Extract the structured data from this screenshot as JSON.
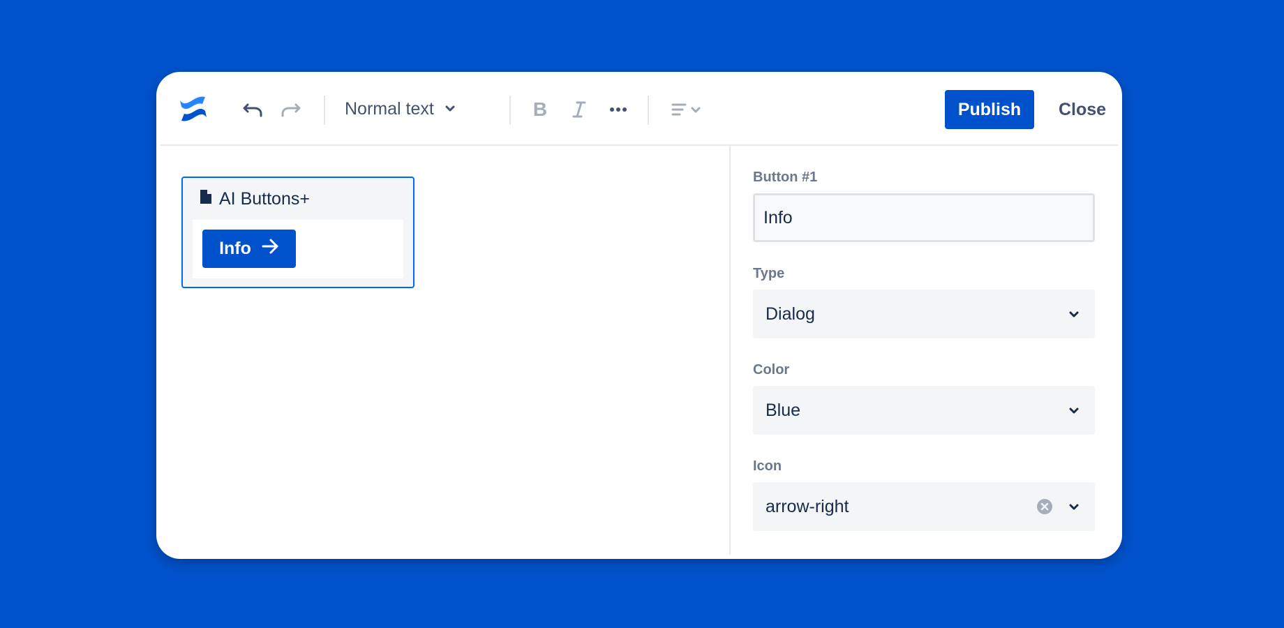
{
  "toolbar": {
    "text_style": "Normal text",
    "bold_label": "B",
    "publish_label": "Publish",
    "close_label": "Close",
    "icons": [
      "confluence-logo-icon",
      "undo-icon",
      "redo-icon",
      "chevron-down-icon",
      "bold-icon",
      "italic-icon",
      "more-icon",
      "align-left-icon"
    ]
  },
  "macro": {
    "title": "AI Buttons+",
    "icon": "document-icon",
    "button": {
      "label": "Info",
      "icon": "arrow-right-icon"
    }
  },
  "panel": {
    "button_label": "Button #1",
    "button_value": "Info",
    "type_label": "Type",
    "type_value": "Dialog",
    "color_label": "Color",
    "color_value": "Blue",
    "icon_label": "Icon",
    "icon_value": "arrow-right"
  },
  "colors": {
    "background": "#0052CC",
    "primary": "#0052CC",
    "selection_border": "#0065FF",
    "text": "#172B4D",
    "muted_text": "#6B778C"
  }
}
